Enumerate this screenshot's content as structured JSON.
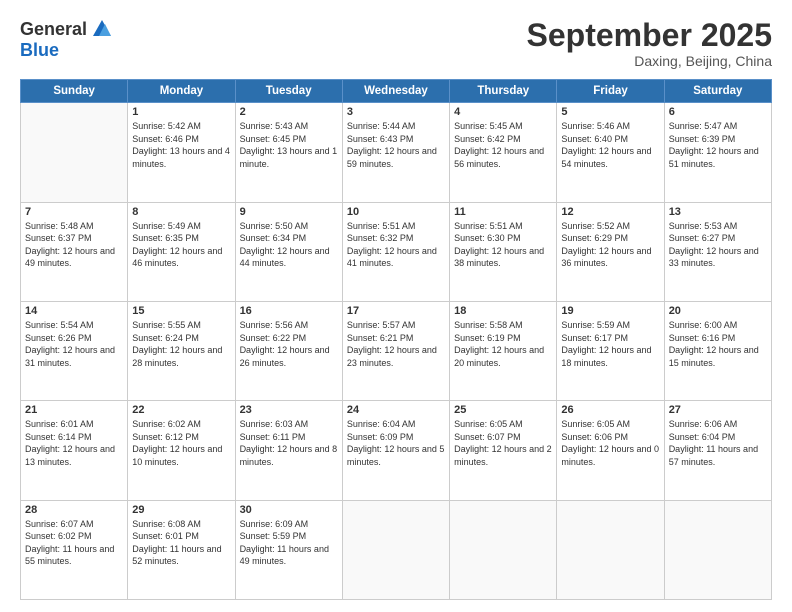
{
  "logo": {
    "general": "General",
    "blue": "Blue"
  },
  "header": {
    "month": "September 2025",
    "location": "Daxing, Beijing, China"
  },
  "weekdays": [
    "Sunday",
    "Monday",
    "Tuesday",
    "Wednesday",
    "Thursday",
    "Friday",
    "Saturday"
  ],
  "weeks": [
    [
      {
        "day": "",
        "sunrise": "",
        "sunset": "",
        "daylight": ""
      },
      {
        "day": "1",
        "sunrise": "Sunrise: 5:42 AM",
        "sunset": "Sunset: 6:46 PM",
        "daylight": "Daylight: 13 hours and 4 minutes."
      },
      {
        "day": "2",
        "sunrise": "Sunrise: 5:43 AM",
        "sunset": "Sunset: 6:45 PM",
        "daylight": "Daylight: 13 hours and 1 minute."
      },
      {
        "day": "3",
        "sunrise": "Sunrise: 5:44 AM",
        "sunset": "Sunset: 6:43 PM",
        "daylight": "Daylight: 12 hours and 59 minutes."
      },
      {
        "day": "4",
        "sunrise": "Sunrise: 5:45 AM",
        "sunset": "Sunset: 6:42 PM",
        "daylight": "Daylight: 12 hours and 56 minutes."
      },
      {
        "day": "5",
        "sunrise": "Sunrise: 5:46 AM",
        "sunset": "Sunset: 6:40 PM",
        "daylight": "Daylight: 12 hours and 54 minutes."
      },
      {
        "day": "6",
        "sunrise": "Sunrise: 5:47 AM",
        "sunset": "Sunset: 6:39 PM",
        "daylight": "Daylight: 12 hours and 51 minutes."
      }
    ],
    [
      {
        "day": "7",
        "sunrise": "Sunrise: 5:48 AM",
        "sunset": "Sunset: 6:37 PM",
        "daylight": "Daylight: 12 hours and 49 minutes."
      },
      {
        "day": "8",
        "sunrise": "Sunrise: 5:49 AM",
        "sunset": "Sunset: 6:35 PM",
        "daylight": "Daylight: 12 hours and 46 minutes."
      },
      {
        "day": "9",
        "sunrise": "Sunrise: 5:50 AM",
        "sunset": "Sunset: 6:34 PM",
        "daylight": "Daylight: 12 hours and 44 minutes."
      },
      {
        "day": "10",
        "sunrise": "Sunrise: 5:51 AM",
        "sunset": "Sunset: 6:32 PM",
        "daylight": "Daylight: 12 hours and 41 minutes."
      },
      {
        "day": "11",
        "sunrise": "Sunrise: 5:51 AM",
        "sunset": "Sunset: 6:30 PM",
        "daylight": "Daylight: 12 hours and 38 minutes."
      },
      {
        "day": "12",
        "sunrise": "Sunrise: 5:52 AM",
        "sunset": "Sunset: 6:29 PM",
        "daylight": "Daylight: 12 hours and 36 minutes."
      },
      {
        "day": "13",
        "sunrise": "Sunrise: 5:53 AM",
        "sunset": "Sunset: 6:27 PM",
        "daylight": "Daylight: 12 hours and 33 minutes."
      }
    ],
    [
      {
        "day": "14",
        "sunrise": "Sunrise: 5:54 AM",
        "sunset": "Sunset: 6:26 PM",
        "daylight": "Daylight: 12 hours and 31 minutes."
      },
      {
        "day": "15",
        "sunrise": "Sunrise: 5:55 AM",
        "sunset": "Sunset: 6:24 PM",
        "daylight": "Daylight: 12 hours and 28 minutes."
      },
      {
        "day": "16",
        "sunrise": "Sunrise: 5:56 AM",
        "sunset": "Sunset: 6:22 PM",
        "daylight": "Daylight: 12 hours and 26 minutes."
      },
      {
        "day": "17",
        "sunrise": "Sunrise: 5:57 AM",
        "sunset": "Sunset: 6:21 PM",
        "daylight": "Daylight: 12 hours and 23 minutes."
      },
      {
        "day": "18",
        "sunrise": "Sunrise: 5:58 AM",
        "sunset": "Sunset: 6:19 PM",
        "daylight": "Daylight: 12 hours and 20 minutes."
      },
      {
        "day": "19",
        "sunrise": "Sunrise: 5:59 AM",
        "sunset": "Sunset: 6:17 PM",
        "daylight": "Daylight: 12 hours and 18 minutes."
      },
      {
        "day": "20",
        "sunrise": "Sunrise: 6:00 AM",
        "sunset": "Sunset: 6:16 PM",
        "daylight": "Daylight: 12 hours and 15 minutes."
      }
    ],
    [
      {
        "day": "21",
        "sunrise": "Sunrise: 6:01 AM",
        "sunset": "Sunset: 6:14 PM",
        "daylight": "Daylight: 12 hours and 13 minutes."
      },
      {
        "day": "22",
        "sunrise": "Sunrise: 6:02 AM",
        "sunset": "Sunset: 6:12 PM",
        "daylight": "Daylight: 12 hours and 10 minutes."
      },
      {
        "day": "23",
        "sunrise": "Sunrise: 6:03 AM",
        "sunset": "Sunset: 6:11 PM",
        "daylight": "Daylight: 12 hours and 8 minutes."
      },
      {
        "day": "24",
        "sunrise": "Sunrise: 6:04 AM",
        "sunset": "Sunset: 6:09 PM",
        "daylight": "Daylight: 12 hours and 5 minutes."
      },
      {
        "day": "25",
        "sunrise": "Sunrise: 6:05 AM",
        "sunset": "Sunset: 6:07 PM",
        "daylight": "Daylight: 12 hours and 2 minutes."
      },
      {
        "day": "26",
        "sunrise": "Sunrise: 6:05 AM",
        "sunset": "Sunset: 6:06 PM",
        "daylight": "Daylight: 12 hours and 0 minutes."
      },
      {
        "day": "27",
        "sunrise": "Sunrise: 6:06 AM",
        "sunset": "Sunset: 6:04 PM",
        "daylight": "Daylight: 11 hours and 57 minutes."
      }
    ],
    [
      {
        "day": "28",
        "sunrise": "Sunrise: 6:07 AM",
        "sunset": "Sunset: 6:02 PM",
        "daylight": "Daylight: 11 hours and 55 minutes."
      },
      {
        "day": "29",
        "sunrise": "Sunrise: 6:08 AM",
        "sunset": "Sunset: 6:01 PM",
        "daylight": "Daylight: 11 hours and 52 minutes."
      },
      {
        "day": "30",
        "sunrise": "Sunrise: 6:09 AM",
        "sunset": "Sunset: 5:59 PM",
        "daylight": "Daylight: 11 hours and 49 minutes."
      },
      {
        "day": "",
        "sunrise": "",
        "sunset": "",
        "daylight": ""
      },
      {
        "day": "",
        "sunrise": "",
        "sunset": "",
        "daylight": ""
      },
      {
        "day": "",
        "sunrise": "",
        "sunset": "",
        "daylight": ""
      },
      {
        "day": "",
        "sunrise": "",
        "sunset": "",
        "daylight": ""
      }
    ]
  ]
}
